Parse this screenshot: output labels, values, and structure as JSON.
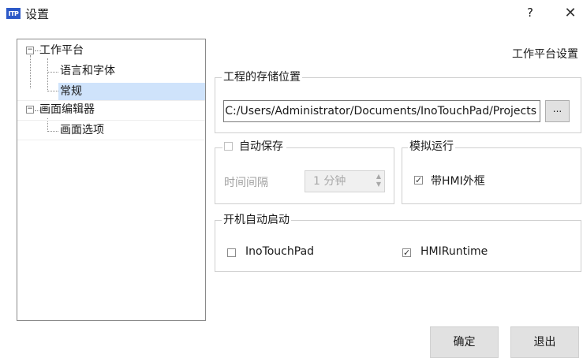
{
  "window": {
    "icon_text": "ITP",
    "title": "设置",
    "help_label": "?",
    "close_label": "✕"
  },
  "tree": {
    "items": [
      {
        "label": "工作平台",
        "expander": "−"
      },
      {
        "label": "语言和字体"
      },
      {
        "label": "常规",
        "selected": true
      },
      {
        "label": "画面编辑器",
        "expander": "−"
      },
      {
        "label": "画面选项"
      }
    ]
  },
  "panel": {
    "title": "工作平台设置",
    "storage": {
      "group_label": "工程的存储位置",
      "path_value": "C:/Users/Administrator/Documents/InoTouchPad/Projects",
      "browse_label": "..."
    },
    "autosave": {
      "label": "自动保存",
      "checked": false,
      "interval_label": "时间间隔",
      "interval_value": "1 分钟",
      "spin_up": "▲",
      "spin_down": "▼"
    },
    "simulate": {
      "group_label": "模拟运行",
      "hmi_frame_label": "带HMI外框",
      "hmi_frame_checked": true
    },
    "startup": {
      "group_label": "开机自动启动",
      "inotouchpad_label": "InoTouchPad",
      "inotouchpad_checked": false,
      "hmiruntime_label": "HMIRuntime",
      "hmiruntime_checked": true
    }
  },
  "buttons": {
    "ok_label": "确定",
    "exit_label": "退出"
  },
  "check_mark": "✓",
  "colors": {
    "selection": "#cfe3fb",
    "button_bg": "#e1e1e1",
    "icon_bg": "#2c59c8"
  }
}
